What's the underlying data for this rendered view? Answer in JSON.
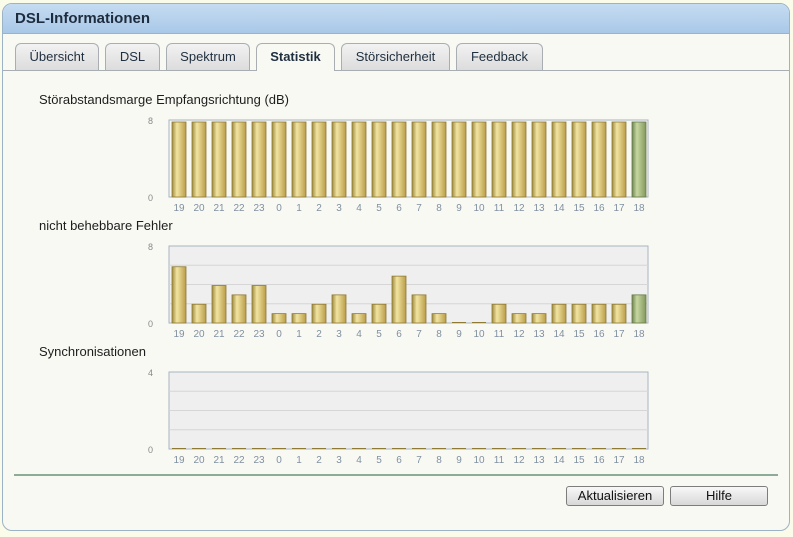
{
  "window": {
    "title": "DSL-Informationen"
  },
  "tabs": [
    {
      "label": "Übersicht"
    },
    {
      "label": "DSL"
    },
    {
      "label": "Spektrum"
    },
    {
      "label": "Statistik",
      "active": true
    },
    {
      "label": "Störsicherheit"
    },
    {
      "label": "Feedback"
    }
  ],
  "charts": {
    "snr_title": "Störabstandsmarge Empfangsrichtung (dB)",
    "errors_title": "nicht behebbare Fehler",
    "sync_title": "Synchronisationen"
  },
  "colors": {
    "bar": "#cfb660",
    "bar_current": "#93a86a",
    "plot_bg": "#efefef",
    "accent": "#a9c8e8"
  },
  "chart_data": [
    {
      "type": "bar",
      "title": "Störabstandsmarge Empfangsrichtung (dB)",
      "categories": [
        "19",
        "20",
        "21",
        "22",
        "23",
        "0",
        "1",
        "2",
        "3",
        "4",
        "5",
        "6",
        "7",
        "8",
        "9",
        "10",
        "11",
        "12",
        "13",
        "14",
        "15",
        "16",
        "17",
        "18"
      ],
      "values": [
        8,
        8,
        8,
        8,
        8,
        8,
        8,
        8,
        8,
        8,
        8,
        8,
        8,
        8,
        8,
        8,
        8,
        8,
        8,
        8,
        8,
        8,
        8,
        8
      ],
      "ylim": [
        0,
        8
      ],
      "yticks": [
        "8",
        "0"
      ]
    },
    {
      "type": "bar",
      "title": "nicht behebbare Fehler",
      "categories": [
        "19",
        "20",
        "21",
        "22",
        "23",
        "0",
        "1",
        "2",
        "3",
        "4",
        "5",
        "6",
        "7",
        "8",
        "9",
        "10",
        "11",
        "12",
        "13",
        "14",
        "15",
        "16",
        "17",
        "18"
      ],
      "values": [
        6,
        2,
        4,
        3,
        4,
        1,
        1,
        2,
        3,
        1,
        2,
        5,
        3,
        1,
        0,
        0,
        2,
        1,
        1,
        2,
        2,
        2,
        2,
        3
      ],
      "ylim": [
        0,
        8
      ],
      "yticks": [
        "8",
        "0"
      ]
    },
    {
      "type": "bar",
      "title": "Synchronisationen",
      "categories": [
        "19",
        "20",
        "21",
        "22",
        "23",
        "0",
        "1",
        "2",
        "3",
        "4",
        "5",
        "6",
        "7",
        "8",
        "9",
        "10",
        "11",
        "12",
        "13",
        "14",
        "15",
        "16",
        "17",
        "18"
      ],
      "values": [
        0,
        0,
        0,
        0,
        0,
        0,
        0,
        0,
        0,
        0,
        0,
        0,
        0,
        0,
        0,
        0,
        0,
        0,
        0,
        0,
        0,
        0,
        0,
        0
      ],
      "ylim": [
        0,
        4
      ],
      "yticks": [
        "4",
        "0"
      ]
    }
  ],
  "buttons": {
    "refresh": "Aktualisieren",
    "help": "Hilfe"
  }
}
